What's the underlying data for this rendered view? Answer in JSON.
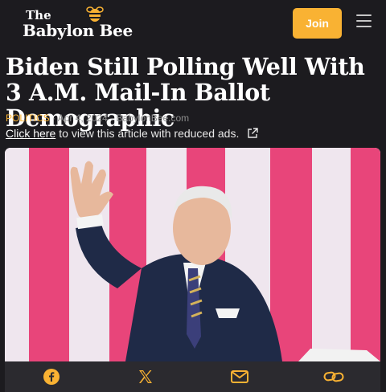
{
  "header": {
    "logo_the": "The",
    "logo_name": "Babylon Bee",
    "join_label": "Join",
    "brand_color": "#f9b233"
  },
  "article": {
    "headline": "Biden Still Polling Well With 3 A.M. Mail-In Ballot Demographic",
    "category": "POLITICS",
    "date": "Apr 4, 2024",
    "source": "BabylonBee.com",
    "reduced_link": "Click here",
    "reduced_text": "to view this article with reduced ads."
  },
  "share": {
    "icons": [
      "facebook-icon",
      "x-icon",
      "email-icon",
      "link-icon"
    ]
  }
}
